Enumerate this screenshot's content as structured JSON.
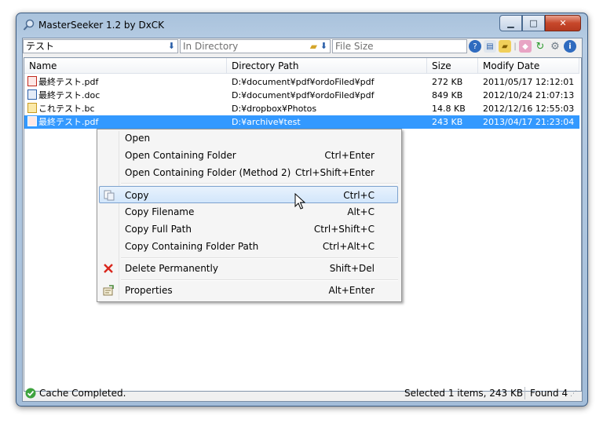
{
  "window": {
    "title": "MasterSeeker 1.2 by DxCK"
  },
  "toolbar": {
    "search_value": "テスト",
    "directory_placeholder": "In Directory",
    "filesize_placeholder": "File Size"
  },
  "columns": [
    "Name",
    "Directory Path",
    "Size",
    "Modify Date"
  ],
  "files": [
    {
      "name": "最終テスト.pdf",
      "path": "D:¥document¥pdf¥ordoFiled¥pdf",
      "size": "272 KB",
      "date": "2011/05/17 12:12:01",
      "icon": "pdf-file-icon"
    },
    {
      "name": "最終テスト.doc",
      "path": "D:¥document¥pdf¥ordoFiled¥pdf",
      "size": "849 KB",
      "date": "2012/10/24 21:07:13",
      "icon": "word-file-icon"
    },
    {
      "name": "これテスト.bc",
      "path": "D:¥dropbox¥Photos",
      "size": "14.8 KB",
      "date": "2012/12/16 12:55:03",
      "icon": "file-icon"
    },
    {
      "name": "最終テスト.pdf",
      "path": "D:¥archive¥test",
      "size": "243 KB",
      "date": "2013/04/17 21:23:04",
      "icon": "pdf-file-icon"
    }
  ],
  "context_menu": {
    "open": "Open",
    "open_folder": "Open Containing Folder",
    "open_folder_acc": "Ctrl+Enter",
    "open_folder2": "Open Containing Folder (Method 2)",
    "open_folder2_acc": "Ctrl+Shift+Enter",
    "copy": "Copy",
    "copy_acc": "Ctrl+C",
    "copy_filename": "Copy Filename",
    "copy_filename_acc": "Alt+C",
    "copy_full_path": "Copy Full Path",
    "copy_full_path_acc": "Ctrl+Shift+C",
    "copy_folder_path": "Copy Containing Folder Path",
    "copy_folder_path_acc": "Ctrl+Alt+C",
    "delete": "Delete Permanently",
    "delete_acc": "Shift+Del",
    "properties": "Properties",
    "properties_acc": "Alt+Enter"
  },
  "status": {
    "cache": "Cache Completed.",
    "selected": "Selected 1 items, 243 KB",
    "found": "Found 4"
  },
  "colors": {
    "selection": "#3399ff",
    "menu_highlight_border": "#7da2ce",
    "delete_icon": "#d9261c"
  }
}
